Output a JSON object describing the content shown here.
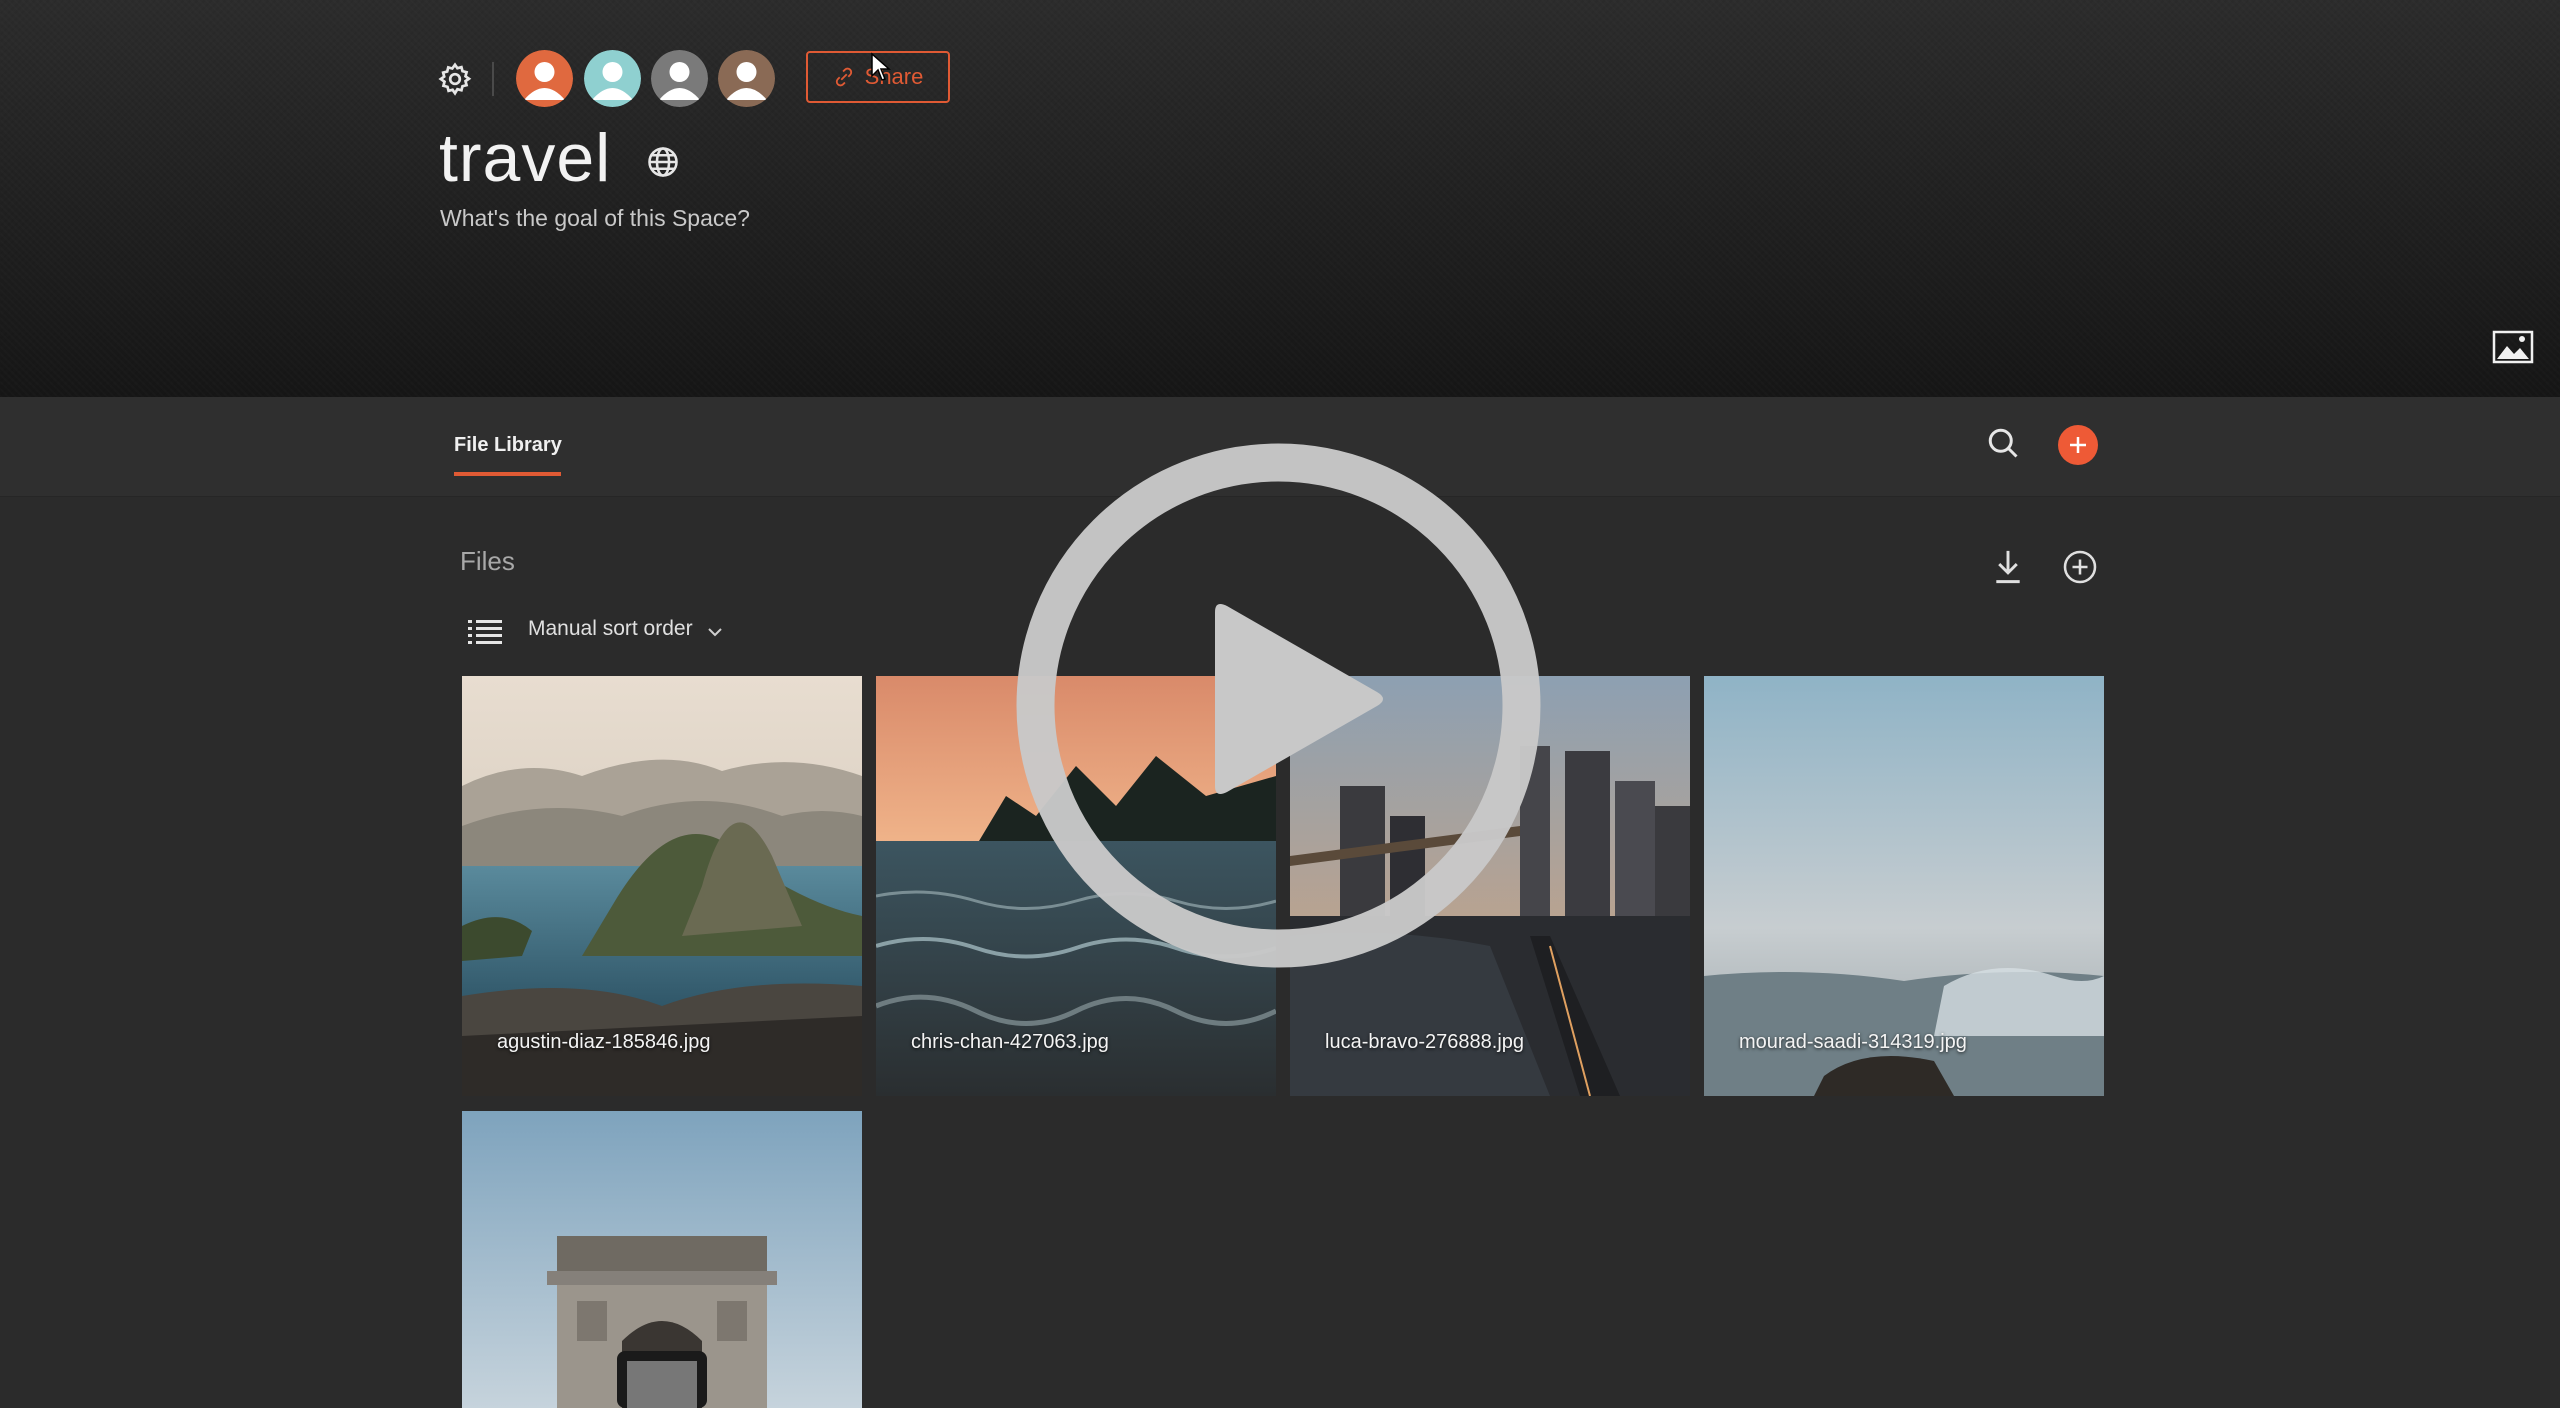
{
  "header": {
    "title": "travel",
    "subtitle": "What's the goal of this Space?",
    "share_label": "Share",
    "members": [
      {
        "name": "member-1",
        "color": "#e0693f"
      },
      {
        "name": "member-2",
        "color": "#8fd0d0"
      },
      {
        "name": "member-3",
        "color": "#7a7a7a"
      },
      {
        "name": "member-4",
        "color": "#8a6a55"
      }
    ]
  },
  "tabs": [
    {
      "label": "File Library",
      "active": true
    }
  ],
  "files": {
    "heading": "Files",
    "sort_label": "Manual sort order",
    "items": [
      {
        "name": "agustin-diaz-185846.jpg"
      },
      {
        "name": "chris-chan-427063.jpg"
      },
      {
        "name": "luca-bravo-276888.jpg"
      },
      {
        "name": "mourad-saadi-314319.jpg"
      },
      {
        "name": ""
      }
    ]
  },
  "colors": {
    "accent": "#e05a34",
    "background": "#2b2b2b"
  },
  "icons": [
    "gear-icon",
    "globe-icon",
    "image-icon",
    "search-icon",
    "plus-icon",
    "download-icon",
    "list-icon",
    "chevron-down-icon",
    "link-icon",
    "play-icon"
  ]
}
